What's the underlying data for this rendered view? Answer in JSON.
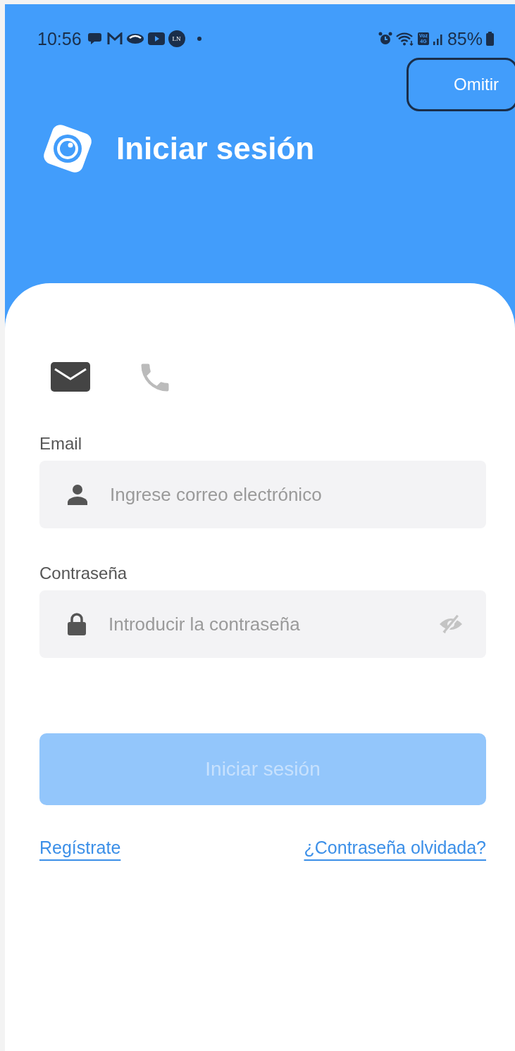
{
  "status_bar": {
    "time": "10:56",
    "notification_badge": "LN",
    "network_badge": [
      "Voz",
      "4G"
    ],
    "battery": "85%"
  },
  "skip_button": {
    "label": "Omitir",
    "focused": true
  },
  "header": {
    "title": "Iniciar sesión"
  },
  "login_methods": [
    {
      "kind": "email",
      "selected": true
    },
    {
      "kind": "phone",
      "selected": false
    }
  ],
  "fields": [
    {
      "kind": "email",
      "label": "Email",
      "placeholder": "Ingrese correo electrónico"
    },
    {
      "kind": "password",
      "label": "Contraseña",
      "placeholder": "Introducir la contraseña"
    }
  ],
  "submit_button": {
    "label": "Iniciar sesión",
    "disabled": true
  },
  "links": [
    "Regístrate",
    "¿Contraseña olvidada?"
  ]
}
